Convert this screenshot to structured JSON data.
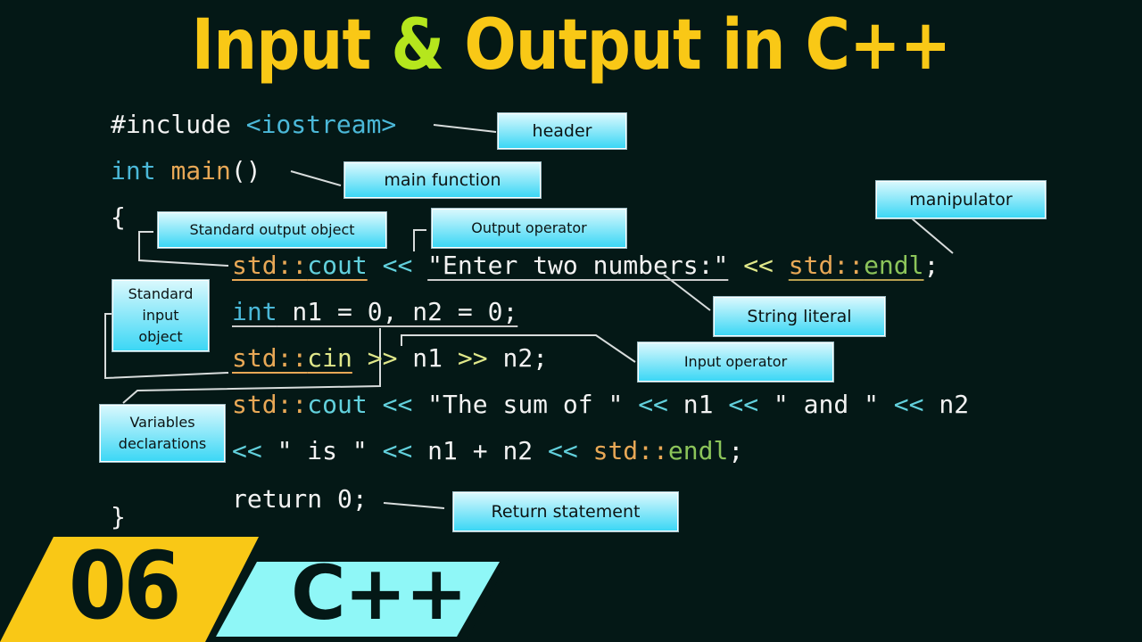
{
  "title": {
    "part1": "Input ",
    "amp": "&",
    "part2": " Output in C++"
  },
  "code": {
    "include_directive": "#include",
    "include_header": "<iostream>",
    "int_kw": "int",
    "main_name": "main",
    "main_parens": "()",
    "open_brace": "{",
    "line3": {
      "ns": "std::",
      "obj": "cout",
      "op1": "<<",
      "str": "\"Enter two numbers:\"",
      "op2": "<<",
      "ns2": "std::",
      "endl": "endl",
      "semi": ";"
    },
    "line4": {
      "kw": "int",
      "rest": " n1 = 0, n2 = 0;"
    },
    "line5": {
      "ns": "std::",
      "obj": "cin",
      "op1": ">>",
      "v1": " n1 ",
      "op2": ">>",
      "v2": " n2;"
    },
    "line6": {
      "ns": "std::",
      "obj": "cout",
      "op1": "<<",
      "s1": " \"The sum of \" ",
      "op2": "<<",
      "v1": " n1 ",
      "op3": "<<",
      "s2": " \" and \" ",
      "op4": "<<",
      "v2": " n2"
    },
    "line7": {
      "op1": "<<",
      "s1": " \" is \" ",
      "op2": "<<",
      "expr": " n1 + n2 ",
      "op3": "<<",
      "ns": " std::",
      "endl": "endl",
      "semi": ";"
    },
    "return_stmt": "return 0;",
    "close_brace": "}"
  },
  "labels": {
    "header": "header",
    "main_function": "main function",
    "manipulator": "manipulator",
    "std_output_object": "Standard output object",
    "output_operator": "Output operator",
    "std_input_object": "Standard input object",
    "string_literal": "String literal",
    "input_operator": "Input operator",
    "variables_declarations": "Variables declarations",
    "return_statement": "Return statement"
  },
  "badge": {
    "number": "06",
    "language": "C++"
  },
  "colors": {
    "background": "#041816",
    "title": "#f9c816",
    "amp": "#b5e61d",
    "badge_number_bg": "#f9c816",
    "badge_lang_bg": "#8ff7f7"
  }
}
